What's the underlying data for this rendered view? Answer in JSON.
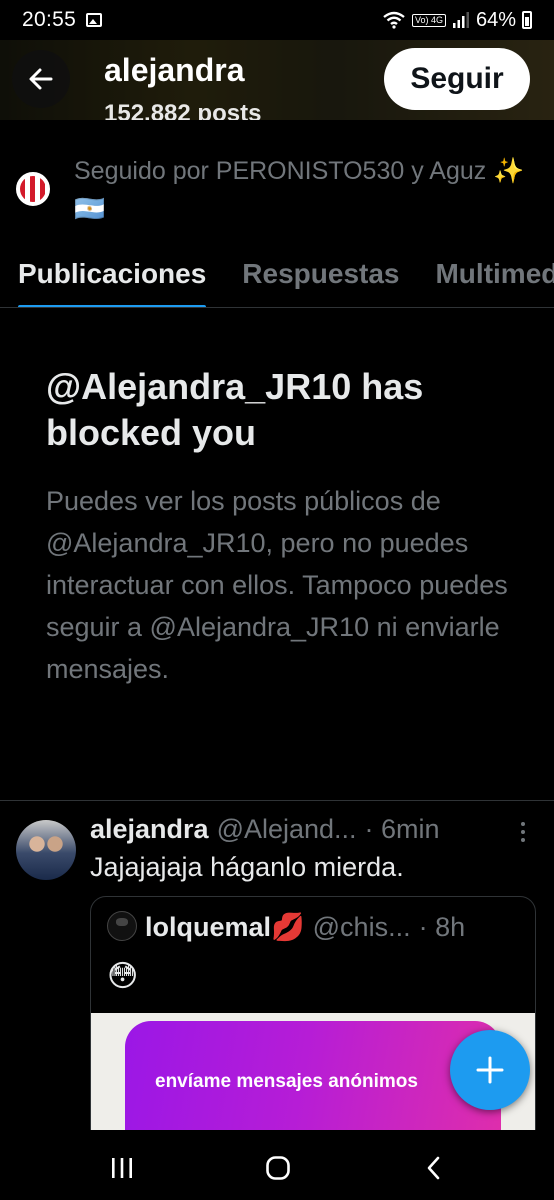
{
  "status_bar": {
    "time": "20:55",
    "volte_label": "Vo) 4G",
    "battery": "64%"
  },
  "header": {
    "name": "alejandra",
    "posts_count": "152.882 posts",
    "follow_label": "Seguir"
  },
  "followed_by": {
    "text": "Seguido por PERONISTO530 y Aguz ✨🇦🇷"
  },
  "tabs": [
    {
      "label": "Publicaciones",
      "active": true
    },
    {
      "label": "Respuestas",
      "active": false
    },
    {
      "label": "Multimedia",
      "active": false
    }
  ],
  "blocked": {
    "title": "@Alejandra_JR10 has blocked you",
    "body": "Puedes ver los posts públicos de @Alejandra_JR10, pero no puedes interactuar con ellos. Tampoco puedes seguir a @Alejandra_JR10 ni enviarle mensajes."
  },
  "post": {
    "name": "alejandra",
    "handle": "@Alejand...",
    "time": "· 6min",
    "text": "Jajajajaja háganlo mierda.",
    "quote": {
      "name": "lolquemal💋",
      "handle": "@chis...",
      "time": "· 8h",
      "text": "😳",
      "image_text": "envíame mensajes anónimos"
    }
  },
  "colors": {
    "background": "#000000",
    "accent": "#1d9bf0",
    "text_primary": "#e7e9ea",
    "text_secondary": "#71767b",
    "border": "#2f3336"
  },
  "icons": [
    "back-arrow-icon",
    "plus-icon",
    "more-vertical-icon",
    "recents-icon",
    "home-icon",
    "back-nav-icon"
  ]
}
